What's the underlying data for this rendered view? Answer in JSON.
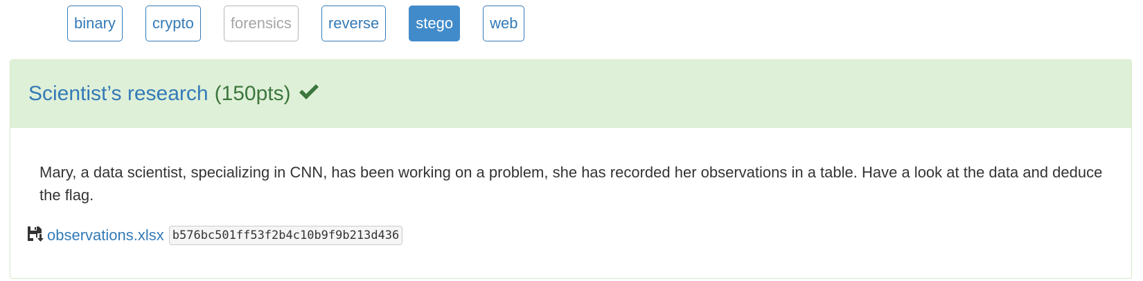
{
  "categories": [
    {
      "label": "binary",
      "state": "normal"
    },
    {
      "label": "crypto",
      "state": "normal"
    },
    {
      "label": "forensics",
      "state": "disabled"
    },
    {
      "label": "reverse",
      "state": "normal"
    },
    {
      "label": "stego",
      "state": "active"
    },
    {
      "label": "web",
      "state": "normal"
    }
  ],
  "challenge": {
    "title": "Scientist’s research",
    "points": "(150pts)",
    "solved_icon": "check-icon",
    "description": "Mary, a data scientist, specializing in CNN, has been working on a problem, she has recorded her observations in a table. Have a look at the data and deduce the flag.",
    "file": {
      "icon": "save-icon",
      "name": "observations.xlsx",
      "hash": "b576bc501ff53f2b4c10b9f9b213d436"
    }
  },
  "colors": {
    "link": "#337ab7",
    "success_bg": "#dff0d8",
    "success_text": "#3c763d",
    "active_btn": "#428bca"
  }
}
